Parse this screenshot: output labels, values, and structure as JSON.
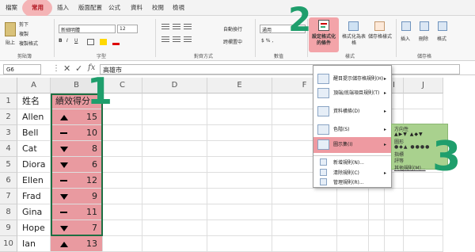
{
  "menu_tabs": [
    "檔案",
    "常用",
    "插入",
    "版面配置",
    "公式",
    "資料",
    "校閱",
    "檢視"
  ],
  "ribbon": {
    "paste": "貼上",
    "cut": "剪下",
    "copy": "複製",
    "format_painter": "複製格式",
    "font_name": "新細明體",
    "font_size": "12",
    "wrap_text": "自動換行",
    "merge_center": "跨欄置中",
    "number_format": "通用",
    "conditional_formatting": "設定格式化的條件",
    "format_as_table": "格式化為表格",
    "cell_styles": "儲存格樣式",
    "insert": "插入",
    "delete": "刪除",
    "format": "格式",
    "groups": {
      "clipboard": "剪貼簿",
      "font": "字型",
      "alignment": "對齊方式",
      "number": "數值",
      "styles": "樣式",
      "cells": "儲存格"
    }
  },
  "formula_bar": {
    "name_box": "G6",
    "value": "高雄市",
    "fx": "fx"
  },
  "columns": [
    "A",
    "B",
    "C",
    "D",
    "E",
    "F",
    "G",
    "H",
    "I",
    "J"
  ],
  "sheet": {
    "headers": [
      "姓名",
      "績效得分"
    ],
    "rows": [
      {
        "n": "2",
        "name": "Allen",
        "icon": "up",
        "score": "15"
      },
      {
        "n": "3",
        "name": "Bell",
        "icon": "neutral",
        "score": "10"
      },
      {
        "n": "4",
        "name": "Cat",
        "icon": "down",
        "score": "8"
      },
      {
        "n": "5",
        "name": "Diora",
        "icon": "down",
        "score": "6"
      },
      {
        "n": "6",
        "name": "Ellen",
        "icon": "neutral",
        "score": "12"
      },
      {
        "n": "7",
        "name": "Frad",
        "icon": "down",
        "score": "9"
      },
      {
        "n": "8",
        "name": "Gina",
        "icon": "neutral",
        "score": "11"
      },
      {
        "n": "9",
        "name": "Hope",
        "icon": "down",
        "score": "7"
      },
      {
        "n": "10",
        "name": "Ian",
        "icon": "up",
        "score": "13"
      }
    ]
  },
  "cf_menu": {
    "items": [
      "醒目提示儲存格規則(H)",
      "頂端/底端項目規則(T)",
      "資料橫條(D)",
      "色階(S)",
      "圖示集(I)",
      "新增規則(N)...",
      "清除規則(C)",
      "管理規則(R)..."
    ],
    "submenu": {
      "directional": "方向性",
      "shapes": "圖形",
      "indicators": "指標",
      "ratings": "評等",
      "more_rules": "其他規則(M)..."
    }
  },
  "step_numbers": [
    "1",
    "2",
    "3"
  ],
  "colors": {
    "accent_green": "#1f9e6c",
    "highlight_pink": "#e99aa0",
    "submenu_green": "#a9d18e"
  }
}
